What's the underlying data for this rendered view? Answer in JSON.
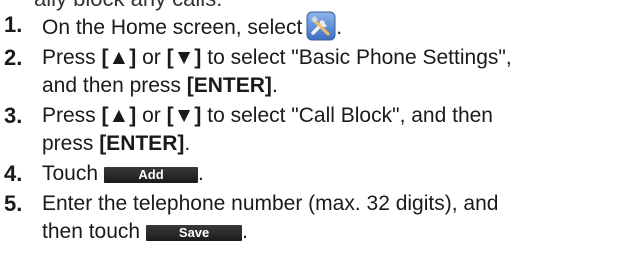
{
  "header_partial": "ally block any calls.",
  "steps": [
    {
      "num": "1.",
      "text": "On the Home screen, select",
      "end": ".",
      "icon": "tools-icon"
    },
    {
      "num": "2.",
      "t1": "Press ",
      "up": "[▲]",
      "mid": " or ",
      "down": "[▼]",
      "t2": " to select \"Basic Phone Settings\",",
      "t3": "and then press ",
      "enter": "[ENTER]",
      "end": "."
    },
    {
      "num": "3.",
      "t1": "Press ",
      "up": "[▲]",
      "mid": " or ",
      "down": "[▼]",
      "t2": " to select \"Call Block\", and then",
      "t3": "press ",
      "enter": "[ENTER]",
      "end": "."
    },
    {
      "num": "4.",
      "text": "Touch",
      "button": "Add",
      "end": "."
    },
    {
      "num": "5.",
      "text": "Enter the telephone number (max. 32 digits), and",
      "t3": "then touch",
      "button": "Save",
      "end": "."
    }
  ],
  "colors": {
    "icon_bg": "#4a7fd0",
    "button_bg": "#222222"
  }
}
